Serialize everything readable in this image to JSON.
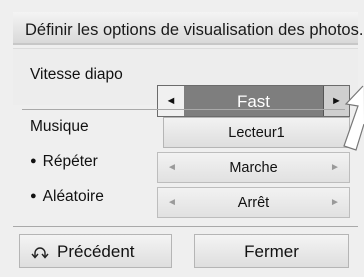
{
  "dialog": {
    "title": "Définir les options de visualisation des photos."
  },
  "slideshow": {
    "label": "Vitesse diapo",
    "value": "Fast",
    "left_icon": "◄",
    "right_icon": "►"
  },
  "music": {
    "label": "Musique",
    "value": "Lecteur1"
  },
  "repeat": {
    "bullet": "●",
    "label": "Répéter",
    "value": "Marche",
    "left_icon": "◄",
    "right_icon": "►"
  },
  "shuffle": {
    "bullet": "●",
    "label": "Aléatoire",
    "value": "Arrêt",
    "left_icon": "◄",
    "right_icon": "►"
  },
  "footer": {
    "back_label": "Précédent",
    "back_icon": "return-arrow-icon",
    "close_label": "Fermer"
  },
  "colors": {
    "selected_bg": "#7e7e7e",
    "panel_bg": "#efefef"
  }
}
